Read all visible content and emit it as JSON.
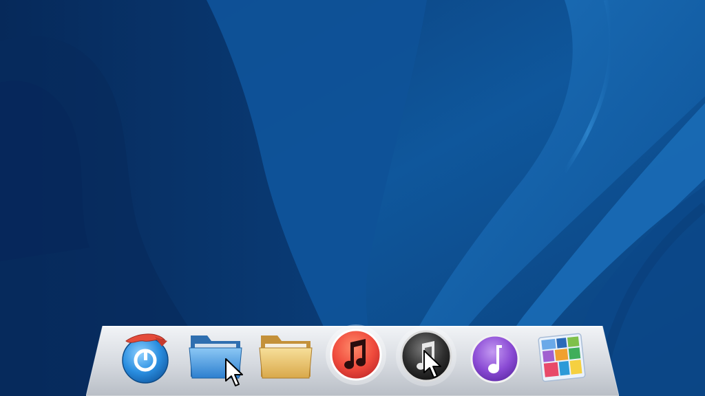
{
  "desktop": {
    "wallpaper_colors": {
      "deep": "#062f63",
      "mid": "#0d4a8c",
      "light": "#1a6ab0",
      "highlight": "#3f8fd4"
    }
  },
  "dock": {
    "shelf_color": "#d9dde3",
    "items": [
      {
        "icon": "browser-globe-icon",
        "accent": "#e44b3a"
      },
      {
        "icon": "blue-folder-icon",
        "accent": "#4a9fe0"
      },
      {
        "icon": "yellow-folder-icon",
        "accent": "#e9c77a"
      },
      {
        "icon": "itunes-red-icon",
        "accent": "#f0523e"
      },
      {
        "icon": "itunes-dark-icon",
        "accent": "#3a3a3a"
      },
      {
        "icon": "music-purple-icon",
        "accent": "#8e4fd6"
      },
      {
        "icon": "tile-app-icon",
        "accent": "#6aa9e8"
      }
    ]
  }
}
